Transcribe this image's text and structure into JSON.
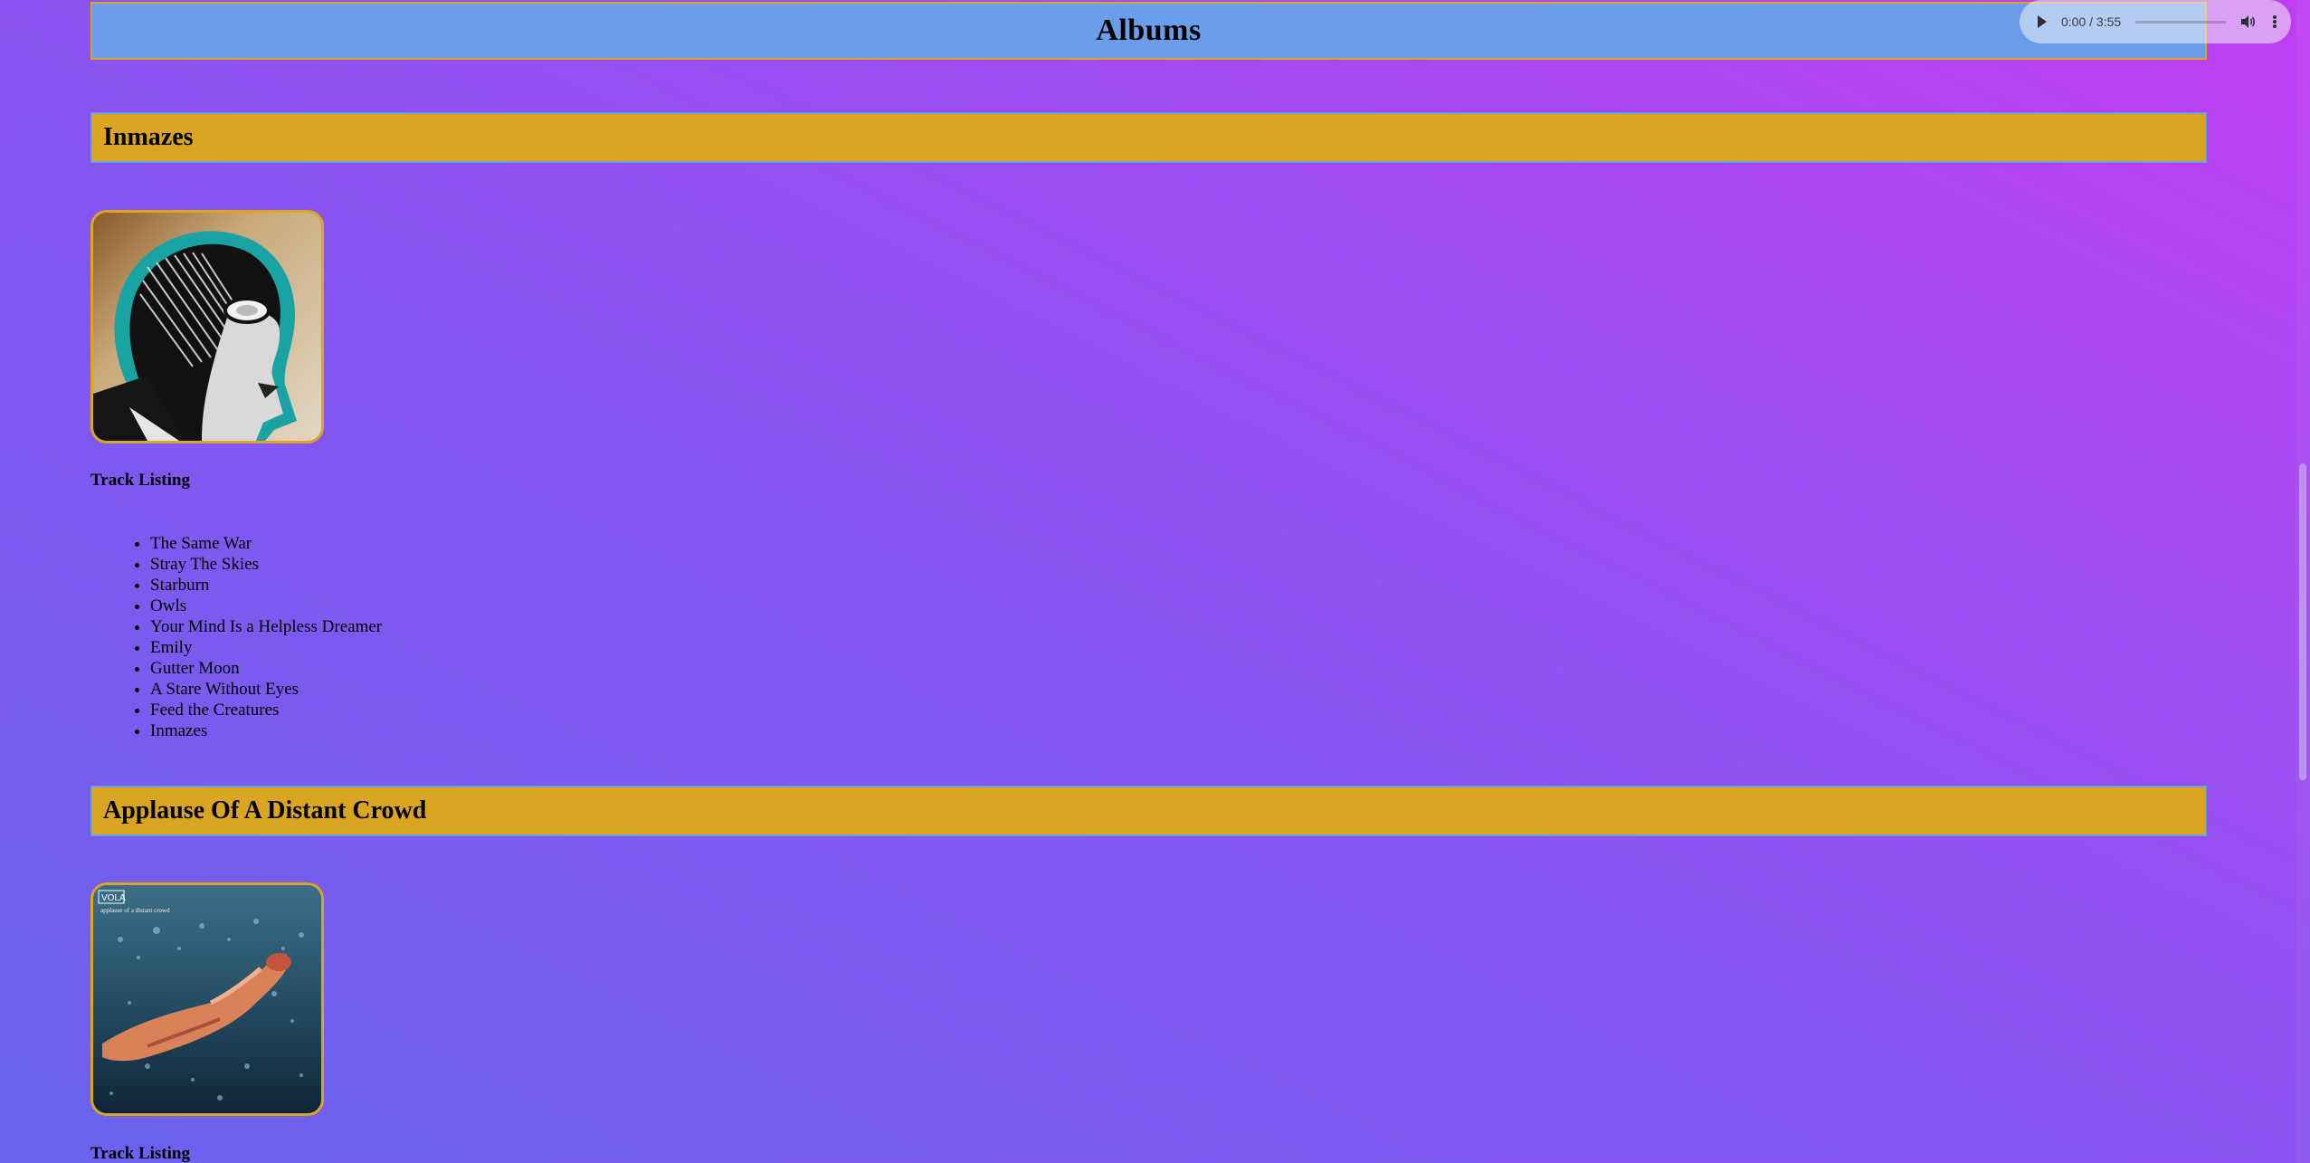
{
  "page": {
    "title": "Albums"
  },
  "audio_player": {
    "time": "0:00 / 3:55",
    "play_icon": "play-icon",
    "volume_icon": "volume-icon",
    "more_icon": "more-options-icon"
  },
  "albums": [
    {
      "title": "Inmazes",
      "cover_alt": "Inmazes album cover",
      "track_heading": "Track Listing",
      "tracks": [
        "The Same War",
        "Stray The Skies",
        "Starburn",
        "Owls",
        "Your Mind Is a Helpless Dreamer",
        "Emily",
        "Gutter Moon",
        "A Stare Without Eyes",
        "Feed the Creatures",
        "Inmazes"
      ]
    },
    {
      "title": "Applause Of A Distant Crowd",
      "cover_alt": "Applause of a Distant Crowd album cover",
      "cover_text": [
        "VOLA",
        "applause of a distant crowd"
      ],
      "track_heading": "Track Listing"
    }
  ],
  "colors": {
    "header_bg": "#6b9eea",
    "album_header_bg": "#daa520",
    "accent_border": "#daa520"
  }
}
